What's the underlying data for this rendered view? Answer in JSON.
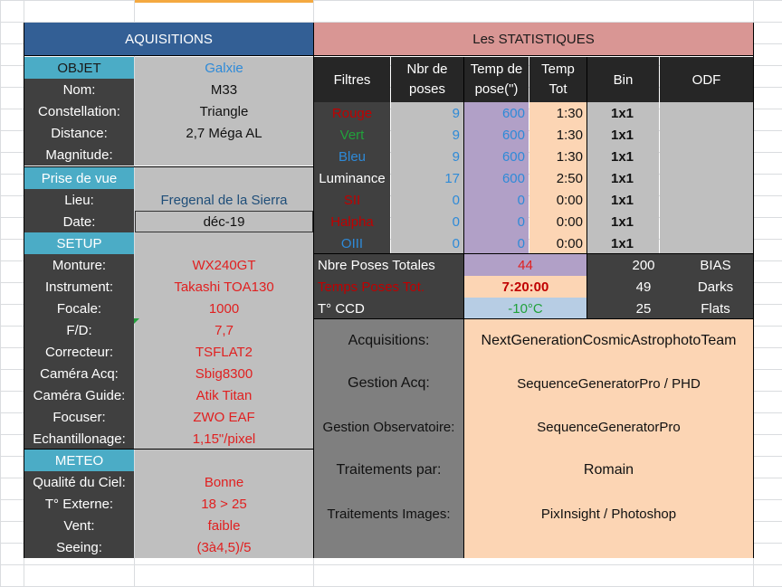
{
  "acq": {
    "header": "AQUISITIONS",
    "objet": {
      "label": "OBJET",
      "value": "Galxie"
    },
    "objet_rows": [
      {
        "label": "Nom:",
        "value": "M33"
      },
      {
        "label": "Constellation:",
        "value": "Triangle"
      },
      {
        "label": "Distance:",
        "value": "2,7 Méga AL"
      },
      {
        "label": "Magnitude:",
        "value": ""
      }
    ],
    "prise": {
      "label": "Prise de vue"
    },
    "prise_rows": [
      {
        "label": "Lieu:",
        "value": "Fregenal de la Sierra"
      },
      {
        "label": "Date:",
        "value": "déc-19"
      }
    ],
    "setup": {
      "label": "SETUP"
    },
    "setup_rows": [
      {
        "label": "Monture:",
        "value": "WX240GT"
      },
      {
        "label": "Instrument:",
        "value": "Takashi TOA130"
      },
      {
        "label": "Focale:",
        "value": "1000"
      },
      {
        "label": "F/D:",
        "value": "7,7"
      },
      {
        "label": "Correcteur:",
        "value": "TSFLAT2"
      },
      {
        "label": "Caméra Acq:",
        "value": "Sbig8300"
      },
      {
        "label": "Caméra Guide:",
        "value": "Atik Titan"
      },
      {
        "label": "Focuser:",
        "value": "ZWO EAF"
      },
      {
        "label": "Echantillonage:",
        "value": "1,15\"/pixel"
      }
    ],
    "meteo": {
      "label": "METEO"
    },
    "meteo_rows": [
      {
        "label": "Qualité du Ciel:",
        "value": "Bonne"
      },
      {
        "label": "T° Externe:",
        "value": "18 > 25"
      },
      {
        "label": "Vent:",
        "value": "faible"
      },
      {
        "label": "Seeing:",
        "value": "(3à4,5)/5"
      }
    ]
  },
  "stats": {
    "header": "Les STATISTIQUES",
    "columns": {
      "filtres": "Filtres",
      "nbr1": "Nbr de",
      "nbr2": "poses",
      "temp1": "Temp de",
      "temp2": "pose(\")",
      "tot1": "Temp",
      "tot2": "Tot",
      "bin": "Bin",
      "odf": "ODF"
    },
    "filters": [
      {
        "name": "Rouge",
        "color": "#c00000",
        "poses": "9",
        "pose": "600",
        "tot": "1:30",
        "bin": "1x1"
      },
      {
        "name": "Vert",
        "color": "#21a13b",
        "poses": "9",
        "pose": "600",
        "tot": "1:30",
        "bin": "1x1"
      },
      {
        "name": "Bleu",
        "color": "#2e8ad8",
        "poses": "9",
        "pose": "600",
        "tot": "1:30",
        "bin": "1x1"
      },
      {
        "name": "Luminance",
        "color": "#ffffff",
        "poses": "17",
        "pose": "600",
        "tot": "2:50",
        "bin": "1x1"
      },
      {
        "name": "SII",
        "color": "#c00000",
        "poses": "0",
        "pose": "0",
        "tot": "0:00",
        "bin": "1x1"
      },
      {
        "name": "Halpha",
        "color": "#c00000",
        "poses": "0",
        "pose": "0",
        "tot": "0:00",
        "bin": "1x1"
      },
      {
        "name": "OIII",
        "color": "#2e8ad8",
        "poses": "0",
        "pose": "0",
        "tot": "0:00",
        "bin": "1x1"
      }
    ],
    "totals": {
      "nbre_label": "Nbre Poses Totales",
      "nbre_value": "44",
      "temps_label": "Temps Poses Tot.",
      "temps_value": "7:20:00",
      "ccd_label": "T° CCD",
      "ccd_value": "-10°C"
    },
    "calib": [
      {
        "count": "200",
        "label": "BIAS"
      },
      {
        "count": "49",
        "label": "Darks"
      },
      {
        "count": "25",
        "label": "Flats"
      }
    ],
    "info": [
      {
        "label": "Acquisitions:",
        "value": "NextGenerationCosmicAstrophotoTeam"
      },
      {
        "label": "Gestion Acq:",
        "value": "SequenceGeneratorPro / PHD"
      },
      {
        "label": "Gestion Observatoire:",
        "value": "SequenceGeneratorPro"
      },
      {
        "label": "Traitements par:",
        "value": "Romain"
      },
      {
        "label": "Traitements Images:",
        "value": "PixInsight / Photoshop"
      }
    ]
  }
}
